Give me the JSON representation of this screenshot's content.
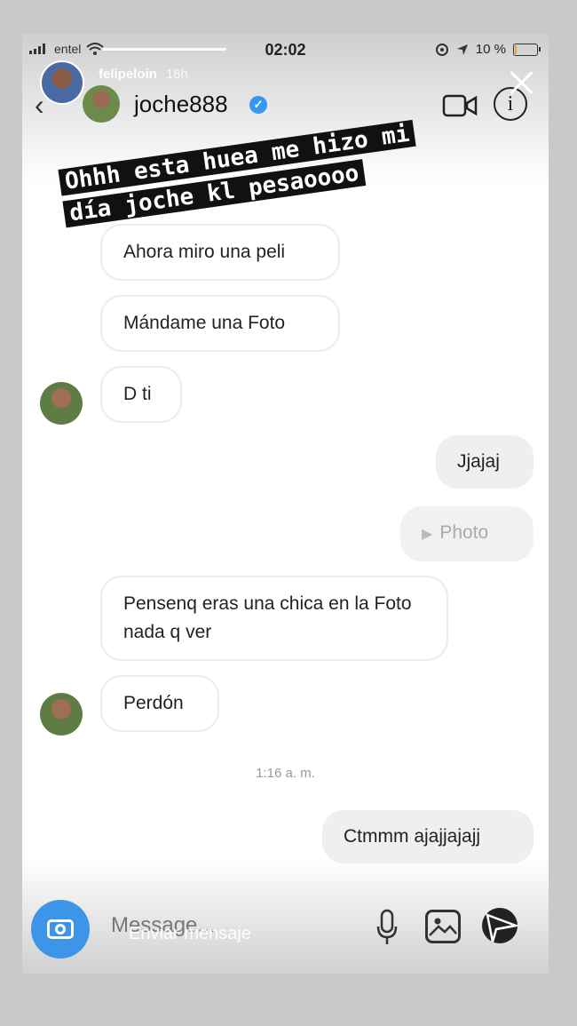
{
  "status_bar": {
    "carrier": "entel",
    "time": "02:02",
    "battery": "10 %",
    "battery_level": 0.1,
    "battery_color": "#e9a33b"
  },
  "story": {
    "username": "felipeloin",
    "age": "18h",
    "caption_line1": "Ohhh esta huea me hizo mi",
    "caption_line2": "día joche kl pesaoooo",
    "reply_placeholder": "Enviar mensaje"
  },
  "chat": {
    "contact_name": "joche888",
    "verified_color": "#3897f0",
    "messages": [
      {
        "from": "them",
        "text": "Ahora miro una peli"
      },
      {
        "from": "them",
        "text": "Mándame una Foto"
      },
      {
        "from": "them",
        "text": "D ti"
      },
      {
        "from": "me",
        "text": "Jjajaj"
      },
      {
        "from": "me",
        "text": "Photo"
      },
      {
        "from": "them",
        "text": "Pensenq eras una chica en la Foto nada q ver"
      },
      {
        "from": "them",
        "text": "Perdón"
      },
      {
        "from": "me",
        "text": "Ctmmm ajajjajajj"
      }
    ],
    "timestamp": "1:16 a. m.",
    "input_placeholder": "Message..."
  },
  "icons": {
    "back": "chevron-left-icon",
    "video": "video-camera-icon",
    "info": "info-icon",
    "camera": "camera-icon",
    "mic": "microphone-icon",
    "gallery": "image-icon",
    "send": "send-arrow-icon",
    "close": "close-icon"
  }
}
